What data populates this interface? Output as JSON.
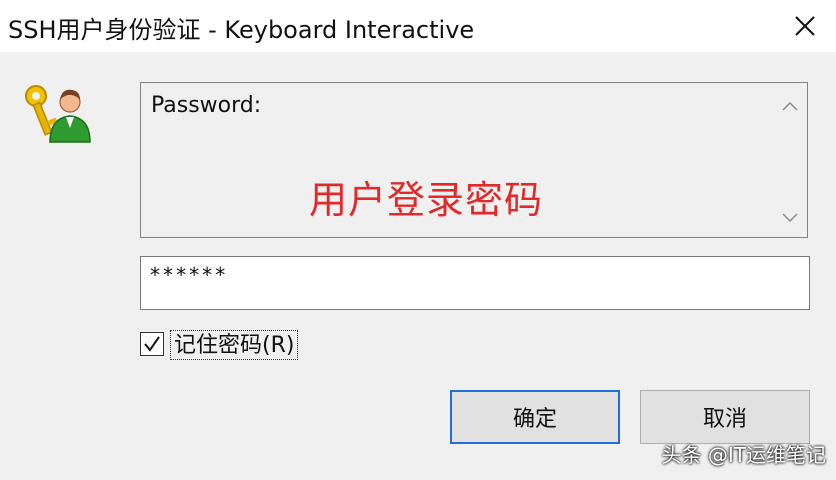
{
  "window": {
    "title": "SSH用户身份验证 - Keyboard Interactive"
  },
  "prompt": {
    "label": "Password:",
    "annotation": "用户登录密码"
  },
  "password_field": {
    "value": "******"
  },
  "remember": {
    "checked": true,
    "label": "记住密码(R)"
  },
  "buttons": {
    "ok": "确定",
    "cancel": "取消"
  },
  "watermark": "头条 @IT运维笔记",
  "colors": {
    "annotation": "#e02a2a",
    "focus_border": "#1e6fd6",
    "window_bg": "#f0f0f0"
  },
  "icons": [
    "key-user-icon",
    "close-icon",
    "scroll-up-icon",
    "scroll-down-icon",
    "checkmark-icon"
  ]
}
